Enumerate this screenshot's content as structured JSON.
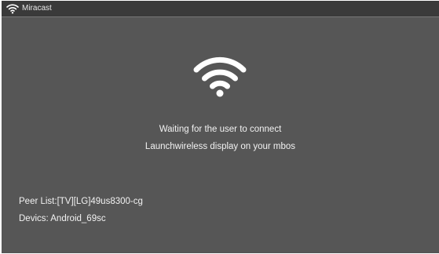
{
  "window": {
    "title": "Miracast",
    "icon": "wifi-icon"
  },
  "main": {
    "icon": "wifi-icon",
    "status_line_1": "Waiting for the user to connect",
    "status_line_2": "Launchwireless display on your mbos",
    "peer_list": "Peer List:[TV][LG]49us8300-cg",
    "device": "Devics: Android_69sc"
  },
  "colors": {
    "screen_background": "#565656",
    "titlebar_background": "#3a3a3a",
    "text": "#f2f2f2",
    "icon": "#ffffff"
  }
}
